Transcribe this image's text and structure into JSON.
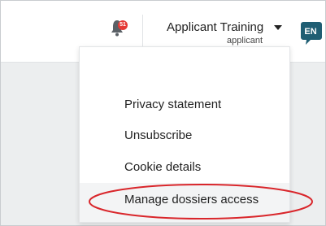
{
  "header": {
    "notification_count": "51",
    "user_name": "Applicant Training",
    "user_role": "applicant",
    "language": "EN"
  },
  "menu": {
    "items": [
      {
        "label": "Privacy statement"
      },
      {
        "label": "Unsubscribe"
      },
      {
        "label": "Cookie details"
      },
      {
        "label": "Manage dossiers access"
      }
    ]
  },
  "colors": {
    "badge": "#e53935",
    "language_badge": "#1f5e73",
    "highlight_ellipse": "#d9262b"
  },
  "icons": [
    "bell-icon",
    "caret-down-icon",
    "language-icon"
  ]
}
